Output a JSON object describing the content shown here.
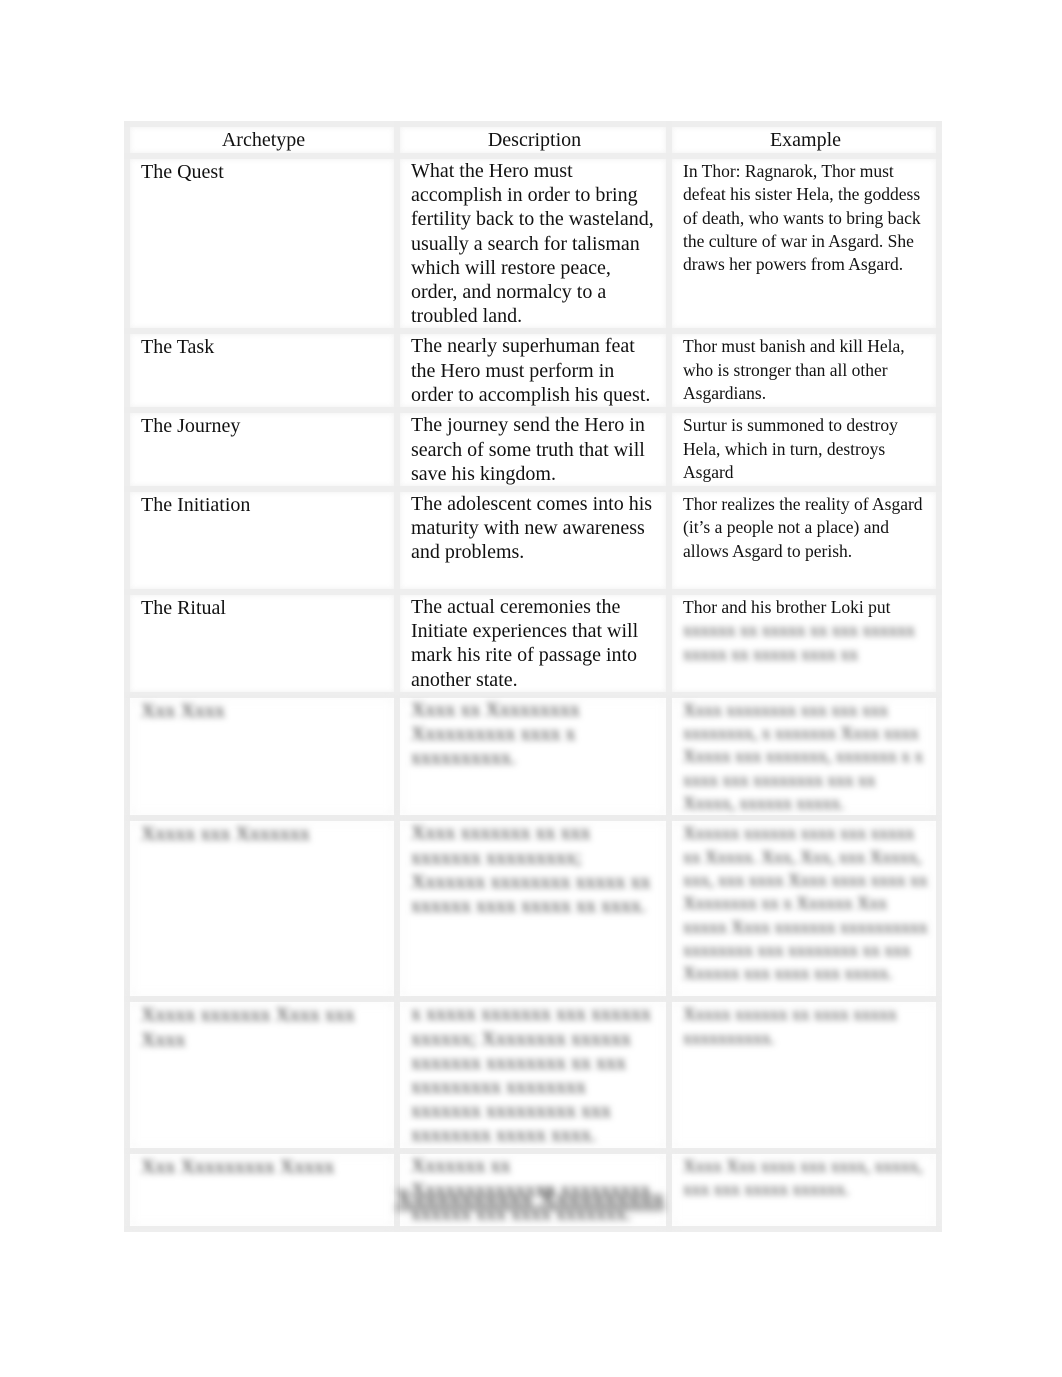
{
  "table": {
    "headers": [
      "Archetype",
      "Description",
      "Example"
    ],
    "rows": [
      {
        "archetype": "The Quest",
        "description": "What the Hero must accomplish in order to bring fertility back to the wasteland, usually a search for talisman which will restore peace, order, and normalcy to a troubled land.",
        "example": "In Thor: Ragnarok, Thor must defeat his sister Hela, the goddess of death, who wants to bring back the culture of war in Asgard. She draws her powers from Asgard."
      },
      {
        "archetype": "The Task",
        "description": "The nearly superhuman feat the Hero must perform in order to accomplish his quest.",
        "example": "Thor must banish and kill Hela, who is stronger than all other Asgardians."
      },
      {
        "archetype": "The Journey",
        "description": "The journey send the Hero in search of some truth that will save his kingdom.",
        "example": "Surtur is summoned to destroy Hela, which in turn, destroys Asgard"
      },
      {
        "archetype": "The Initiation",
        "description": "The adolescent comes into his maturity with new awareness and problems.",
        "example": "Thor realizes the reality of Asgard (it’s a people not a place) and allows Asgard to perish."
      },
      {
        "archetype": "The Ritual",
        "description": "The actual ceremonies the Initiate experiences that will mark his rite of passage into another state.",
        "example": "Thor and his brother Loki put",
        "example_obscured": "xxxxxx xx xxxxx xx xxx xxxxxx xxxxx xx xxxxx xxxx xx"
      }
    ],
    "obscured_rows": [
      {
        "archetype": "Xxx Xxxx",
        "description": "Xxxx xx Xxxxxxxxx Xxxxxxxxxx xxxx x xxxxxxxxxx.",
        "example": "Xxxx xxxxxxxx xxx xxx xxx xxxxxxxx, x xxxxxxx Xxxx xxxx Xxxxx xxx xxxxxxx, xxxxxxx x x xxxx xxx xxxxxxxx xxx xx Xxxxx, xxxxxx xxxxx."
      },
      {
        "archetype": "Xxxxx xxx Xxxxxxx",
        "description": "Xxxx xxxxxxx xx xxx xxxxxxx xxxxxxxxx; Xxxxxxx xxxxxxxx xxxxx xx xxxxxx xxxx xxxxx xx xxxx.",
        "example": "Xxxxxx xxxxxx xxxx xxx xxxxx xx Xxxxx. Xxx, Xxx, xxx Xxxxx, xxx, xxx xxxx Xxxx xxxx xxxx xx Xxxxxxxx xx x Xxxxxx Xxx xxxxx Xxxx xxxxxxx xxxxxxxxxx xxxxxxxx xxx xxxxxxxx xx xxx Xxxxxx xxx xxxx xxx xxxxx."
      },
      {
        "archetype": "Xxxxx xxxxxxx Xxxx xxx Xxxx",
        "description": "x xxxxx xxxxxxx xxx xxxxxx xxxxxx; Xxxxxxxx xxxxxx xxxxxxx xxxxxxxx xx xxx xxxxxxxxx xxxxxxxx xxxxxxx xxxxxxxxx xxx xxxxxxxx xxxxx xxxx.",
        "example": "Xxxxx xxxxxx xx xxxx xxxxx xxxxxxxxxx."
      },
      {
        "archetype": "Xxx Xxxxxxxxx Xxxxx",
        "description": "Xxxxxxx xx Xxxxxxxxxxxxxx xxxxxxxxx xxxxxx xxx xxxx xxxxxxx.",
        "example": "Xxxx Xxx xxxx xxx xxxx, xxxxx, xxx xxx xxxxx xxxxxx."
      }
    ]
  },
  "bottom_heading": "Xxxxxxxxxxx Xxxxxxxxxx"
}
